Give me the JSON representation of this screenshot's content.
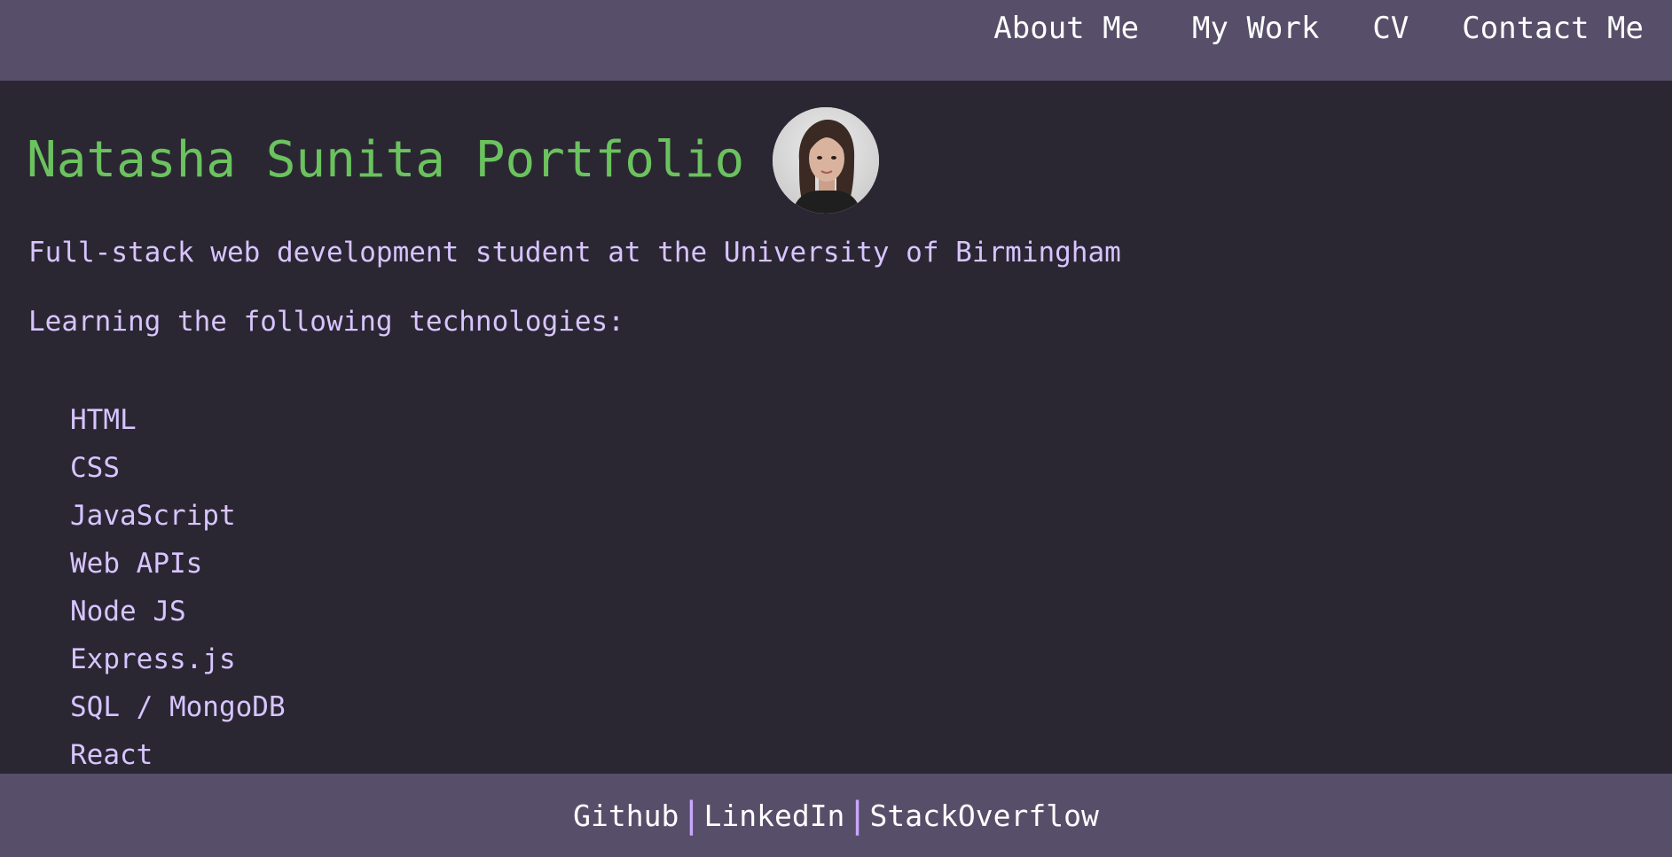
{
  "nav": {
    "about": "About Me",
    "work": "My Work",
    "cv": "CV",
    "contact": "Contact Me"
  },
  "main": {
    "title": "Natasha Sunita Portfolio",
    "tagline": "Full-stack web development student at the University of Birmingham",
    "learning_heading": "Learning the following technologies:",
    "technologies": [
      "HTML",
      "CSS",
      "JavaScript",
      "Web APIs",
      "Node JS",
      "Express.js",
      "SQL / MongoDB",
      "React"
    ]
  },
  "footer": {
    "github": "Github",
    "linkedin": "LinkedIn",
    "stackoverflow": "StackOverflow",
    "separator": "|"
  },
  "colors": {
    "nav_bg": "#574f69",
    "page_bg": "#2a2733",
    "title": "#6bc25e",
    "body_text": "#d8c4ff",
    "separator": "#c9a7ff"
  }
}
